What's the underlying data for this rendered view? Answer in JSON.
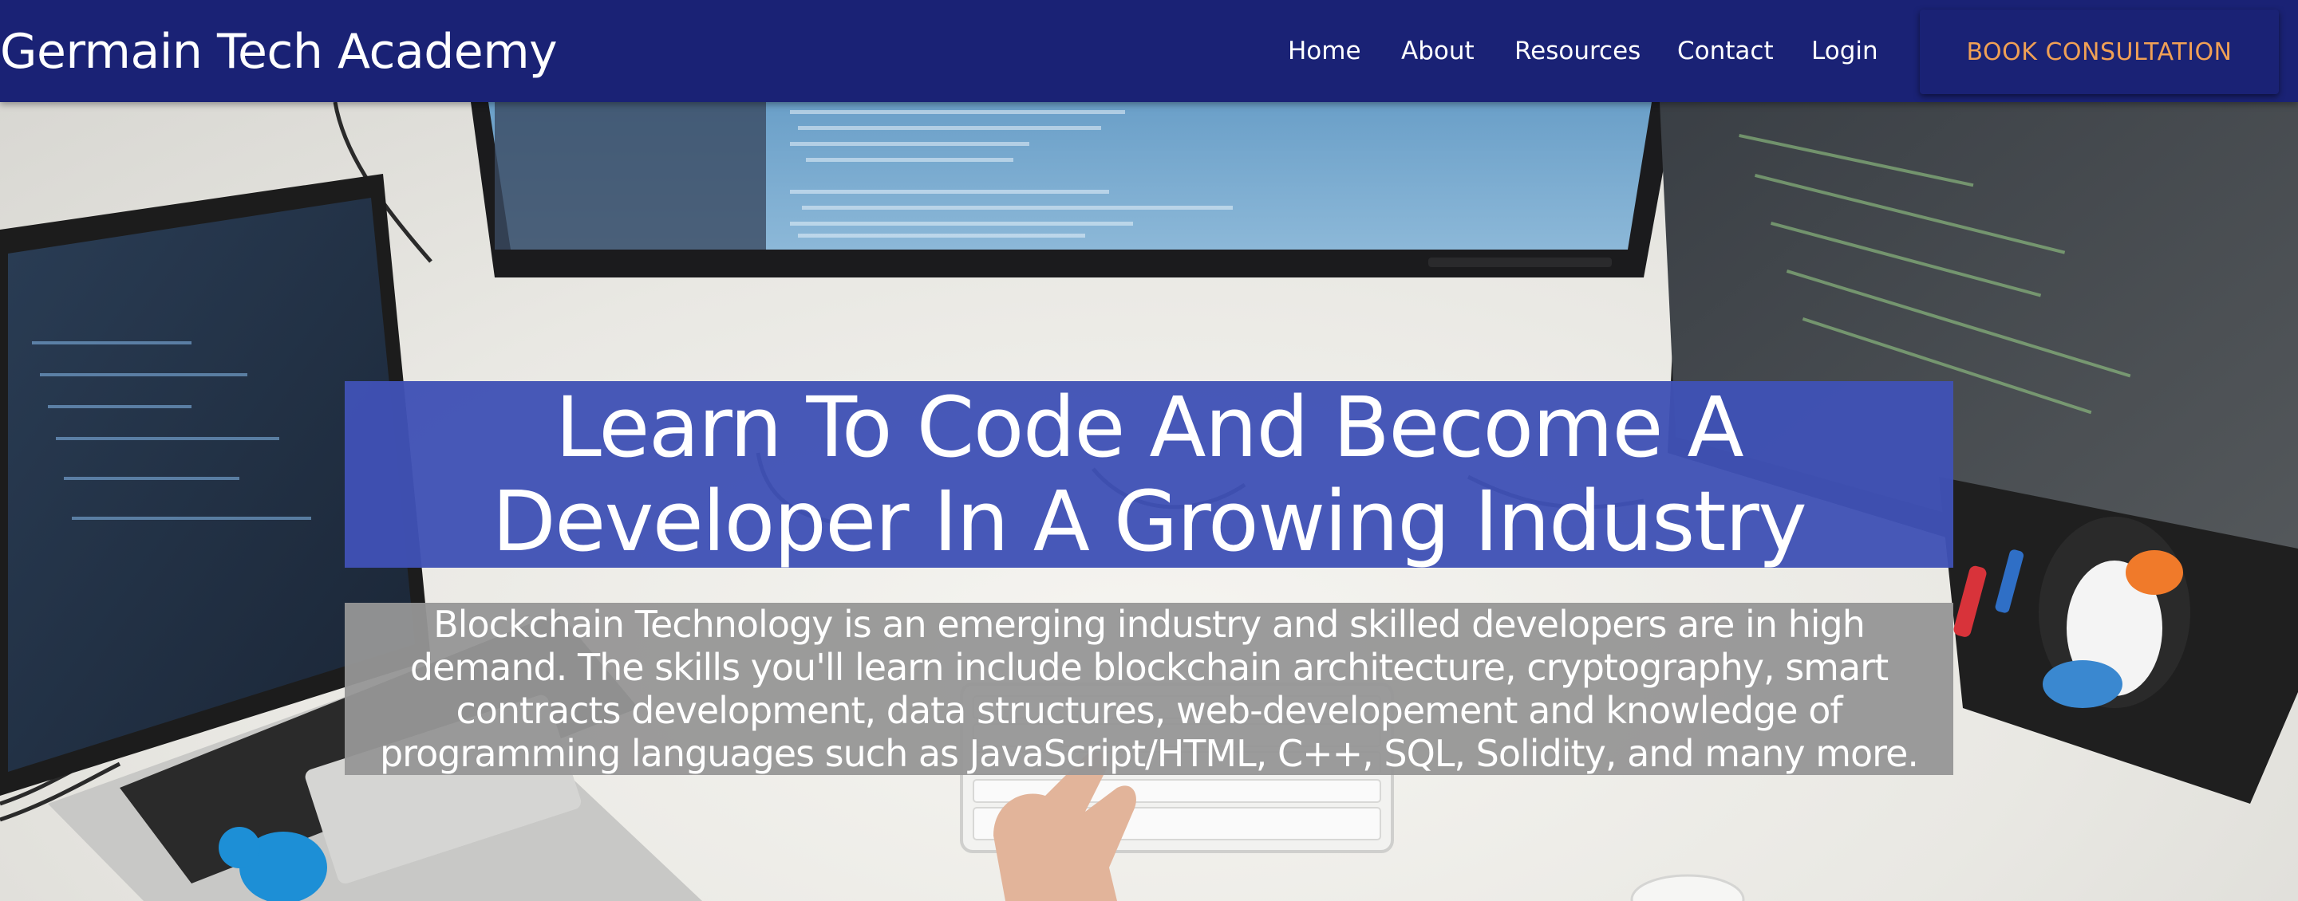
{
  "navbar": {
    "brand": "Germain Tech Academy",
    "links": [
      "Home",
      "About",
      "Resources",
      "Contact",
      "Login"
    ],
    "cta_label": "BOOK CONSULTATION",
    "background_color": "#1a2275",
    "cta_text_color": "#f0a055"
  },
  "hero": {
    "headline": "Learn To Code And Become A Developer In A Growing Industry",
    "description": "Blockchain Technology is an emerging industry and skilled developers are in high demand. The skills you'll learn include blockchain architecture, cryptography, smart contracts development, data structures, web-developement and knowledge of programming languages such as JavaScript/HTML, C++, SQL, Solidity, and many more.",
    "headline_bg_color": "#3f51b5",
    "description_bg_color": "#969696"
  },
  "background_photo": {
    "scene": "desk with laptop, monitors showing code, keyboard, hands typing, mouse, stuffed penguin",
    "icons": [
      "laptop",
      "monitor",
      "keyboard",
      "hand",
      "mouse",
      "penguin",
      "bird-sticker"
    ]
  }
}
